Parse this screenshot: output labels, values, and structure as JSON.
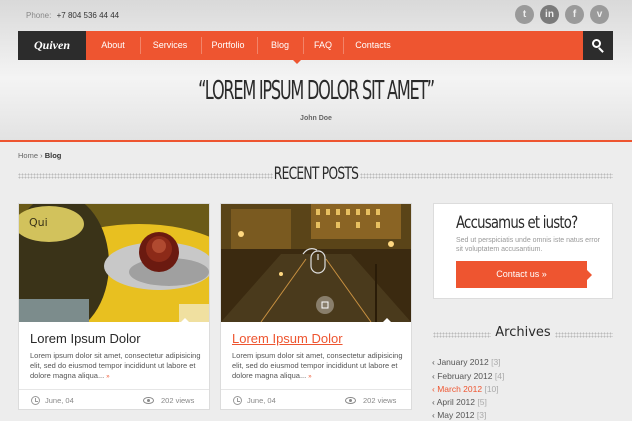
{
  "header": {
    "phone_label": "Phone:",
    "phone_number": "+7 804 536 44 44",
    "social": [
      {
        "icon": "twitter-icon",
        "glyph": "t"
      },
      {
        "icon": "linkedin-icon",
        "glyph": "in"
      },
      {
        "icon": "facebook-icon",
        "glyph": "f"
      },
      {
        "icon": "vimeo-icon",
        "glyph": "v"
      }
    ]
  },
  "nav": {
    "logo": "Quiven",
    "items": [
      "About",
      "Services",
      "Portfolio",
      "Blog",
      "FAQ",
      "Contacts"
    ],
    "active": "Blog",
    "accent_color": "#ee5530",
    "dark_color": "#2c2c2c"
  },
  "hero": {
    "quote": "“LOREM IPSUM DOLOR SIT AMET”",
    "author": "John Doe"
  },
  "breadcrumb": {
    "home": "Home",
    "separator": "›",
    "current": "Blog"
  },
  "section_title": "RECENT POSTS",
  "posts": [
    {
      "title": "Lorem Ipsum Dolor",
      "text": "Lorem ipsum dolor sit amet, consectetur adipisicing elit, sed do eiusmod tempor incididunt ut labore et dolore magna aliqua...",
      "more": "»",
      "date": "June, 04",
      "views": "202 views",
      "highlighted": false
    },
    {
      "title": "Lorem Ipsum Dolor",
      "text": "Lorem ipsum dolor sit amet, consectetur adipisicing elit, sed do eiusmod tempor incididunt ut labore et dolore magna aliqua...",
      "more": "»",
      "date": "June, 04",
      "views": "202 views",
      "highlighted": true
    }
  ],
  "promo": {
    "title": "Accusamus et iusto?",
    "text": "Sed ut perspiciatis unde omnis iste natus error sit voluptatem accusantium.",
    "button": "Contact us »"
  },
  "archives": {
    "title": "Archives",
    "items": [
      {
        "label": "January 2012",
        "count": "[3]",
        "active": false
      },
      {
        "label": "February 2012",
        "count": "[4]",
        "active": false
      },
      {
        "label": "March 2012",
        "count": "[10]",
        "active": true
      },
      {
        "label": "April 2012",
        "count": "[5]",
        "active": false
      },
      {
        "label": "May 2012",
        "count": "[3]",
        "active": false
      }
    ]
  }
}
